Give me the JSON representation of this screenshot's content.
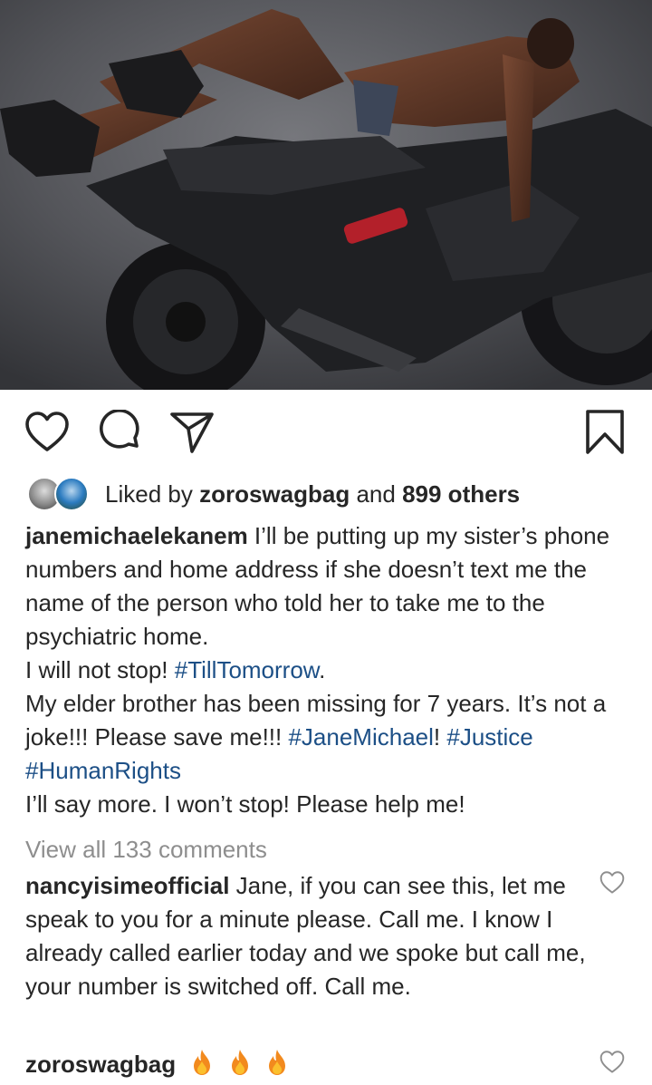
{
  "post": {
    "image_alt": "Photo of a person reclining on a black motorcycle",
    "actions": {
      "like_icon": "heart-outline-icon",
      "comment_icon": "comment-bubble-icon",
      "share_icon": "paper-plane-icon",
      "save_icon": "bookmark-icon"
    },
    "likes": {
      "prefix": "Liked by",
      "user": "zoroswagbag",
      "joiner": "and",
      "others": "899 others"
    },
    "caption": {
      "user": "janemichaelekanem",
      "line1": " I’ll be putting up my sister’s phone numbers and home address if she doesn’t text me the name of the person who told her to take me to the psychiatric home.",
      "line2_text": "I will not stop! ",
      "line2_tag": "#TillTomorrow",
      "line2_end": ".",
      "line3_text": "My elder brother has been missing for 7 years. It’s not a joke!!! Please save me!!! ",
      "line3_tag1": "#JaneMichael",
      "line3_mid": "! ",
      "line3_tag2": "#Justice",
      "line3_sp": " ",
      "line3_tag3": "#HumanRights",
      "line4": "I’ll say more. I won’t stop! Please help me!"
    },
    "view_comments": "View all 133 comments",
    "comments": [
      {
        "user": "nancyisimeofficial",
        "text": " Jane, if you can see this, let me speak to you for a minute please. Call me. I know I already called earlier today and we spoke but call me, your number is switched off. Call me."
      },
      {
        "user": "zoroswagbag",
        "text": "",
        "emoji": "fire-emoji x3"
      }
    ]
  },
  "colors": {
    "text": "#262626",
    "hashtag": "#1c4f86",
    "muted": "#8e8e8e"
  }
}
